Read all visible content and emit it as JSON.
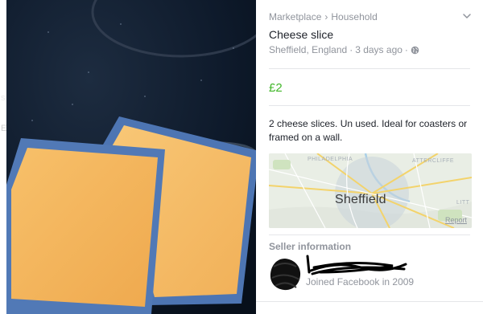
{
  "listing": {
    "breadcrumb": {
      "category": "Marketplace",
      "separator": "›",
      "subcategory": "Household"
    },
    "title": "Cheese slice",
    "location": "Sheffield, England",
    "meta_sep": "·",
    "posted": "3 days ago",
    "price": "£2",
    "description": "2 cheese slices. Un used. Ideal for coasters or framed on a wall."
  },
  "map": {
    "city_label": "Sheffield",
    "area_labels": [
      "PHILADELPHIA",
      "ATTERCLIFFE",
      "LITT"
    ],
    "report_label": "Report"
  },
  "seller": {
    "heading": "Seller information",
    "joined": "Joined Facebook in 2009"
  },
  "photo": {
    "side_text": [
      "s",
      "E"
    ]
  },
  "colors": {
    "price": "#42b72a",
    "muted": "#90949c",
    "text": "#1d2129",
    "cheese": "#f5b860",
    "packaging": "#4f78b8",
    "background_dark": "#0b1626"
  },
  "icons": {
    "expand": "chevron-down-icon",
    "privacy": "globe-icon"
  }
}
